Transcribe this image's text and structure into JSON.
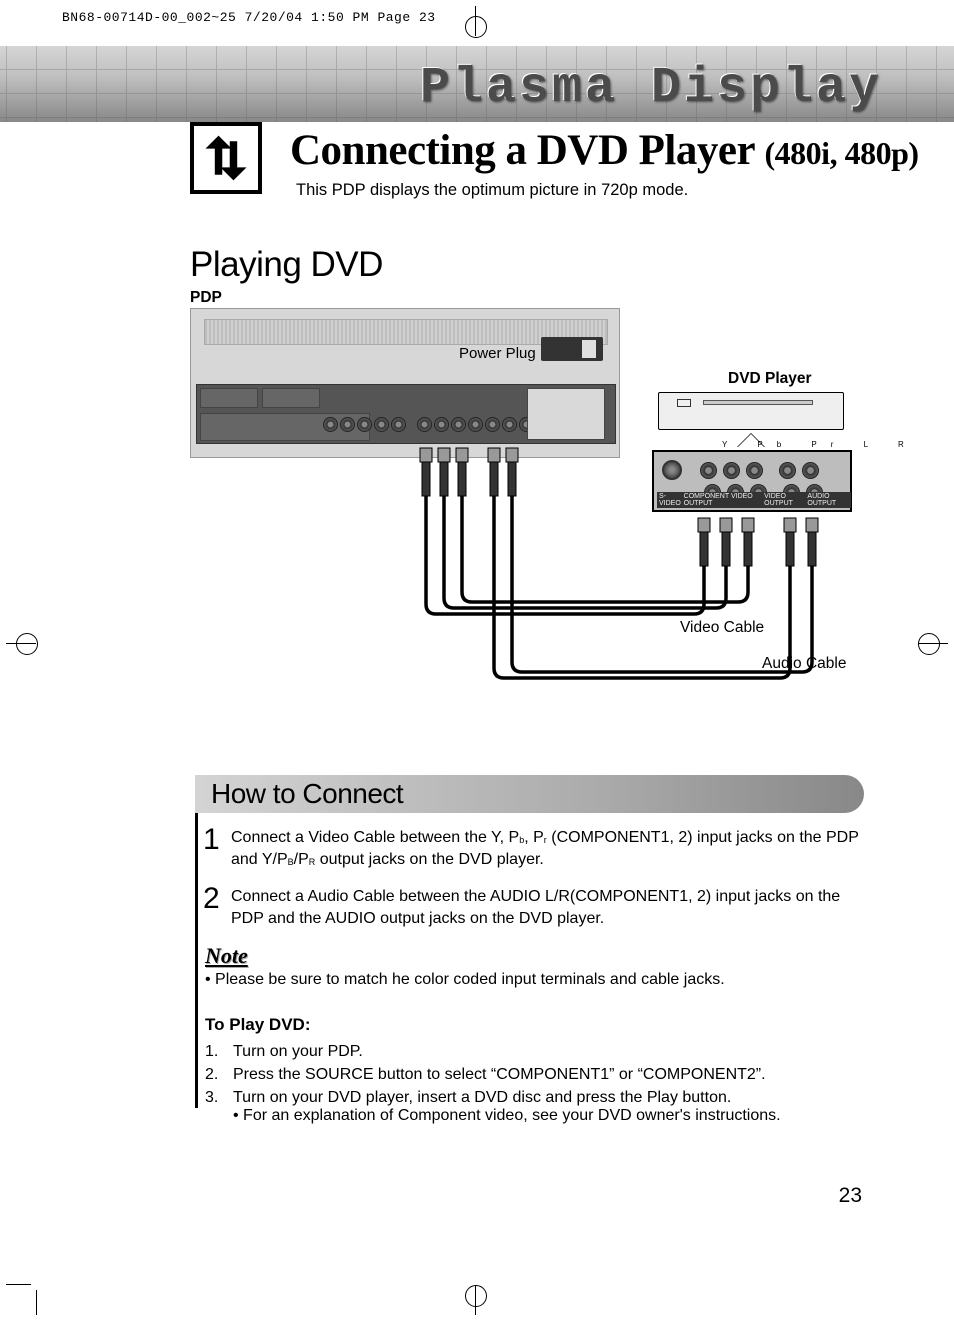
{
  "print_header": "BN68-00714D-00_002~25  7/20/04  1:50 PM  Page 23",
  "banner_title": "Plasma Display",
  "main_title": "Connecting a DVD Player",
  "main_title_sub": "(480i, 480p)",
  "subtitle": "This PDP displays the optimum picture in 720p mode.",
  "section_title": "Playing DVD",
  "diagram": {
    "pdp_label": "PDP",
    "power_plug_label": "Power Plug",
    "dvd_label": "DVD Player",
    "dvd_back_top_labels": "Y   Pb   Pr   L   R",
    "dvd_back_bottom": [
      "S-VIDEO",
      "COMPONENT VIDEO OUTPUT",
      "VIDEO OUTPUT",
      "AUDIO OUTPUT"
    ],
    "video_cable": "Video Cable",
    "audio_cable": "Audio Cable"
  },
  "howto": {
    "title": "How to Connect",
    "steps": [
      {
        "n": "1",
        "text_a": "Connect a Video Cable between the Y, P",
        "sub1": "b",
        "text_b": ", P",
        "sub2": "r",
        "text_c": " (COMPONENT1, 2) input jacks on the PDP and Y/P",
        "sub3": "B",
        "text_d": "/P",
        "sub4": "R",
        "text_e": " output jacks on the DVD player."
      },
      {
        "n": "2",
        "text": "Connect a Audio Cable between the AUDIO L/R(COMPONENT1, 2) input jacks on the PDP and the AUDIO output jacks on the DVD player."
      }
    ],
    "note_heading": "Note",
    "note_bullet": "•   Please be sure to match he color coded input terminals and cable jacks.",
    "toplay_heading": "To Play DVD:",
    "toplay_items": [
      {
        "n": "1.",
        "t": "Turn on your PDP."
      },
      {
        "n": "2.",
        "t": "Press the SOURCE button to select “COMPONENT1” or “COMPONENT2”."
      },
      {
        "n": "3.",
        "t": "Turn on your DVD player, insert a DVD disc and press the Play button.",
        "sub": "• For an explanation of Component video, see your DVD owner's instructions."
      }
    ]
  },
  "page_number": "23"
}
